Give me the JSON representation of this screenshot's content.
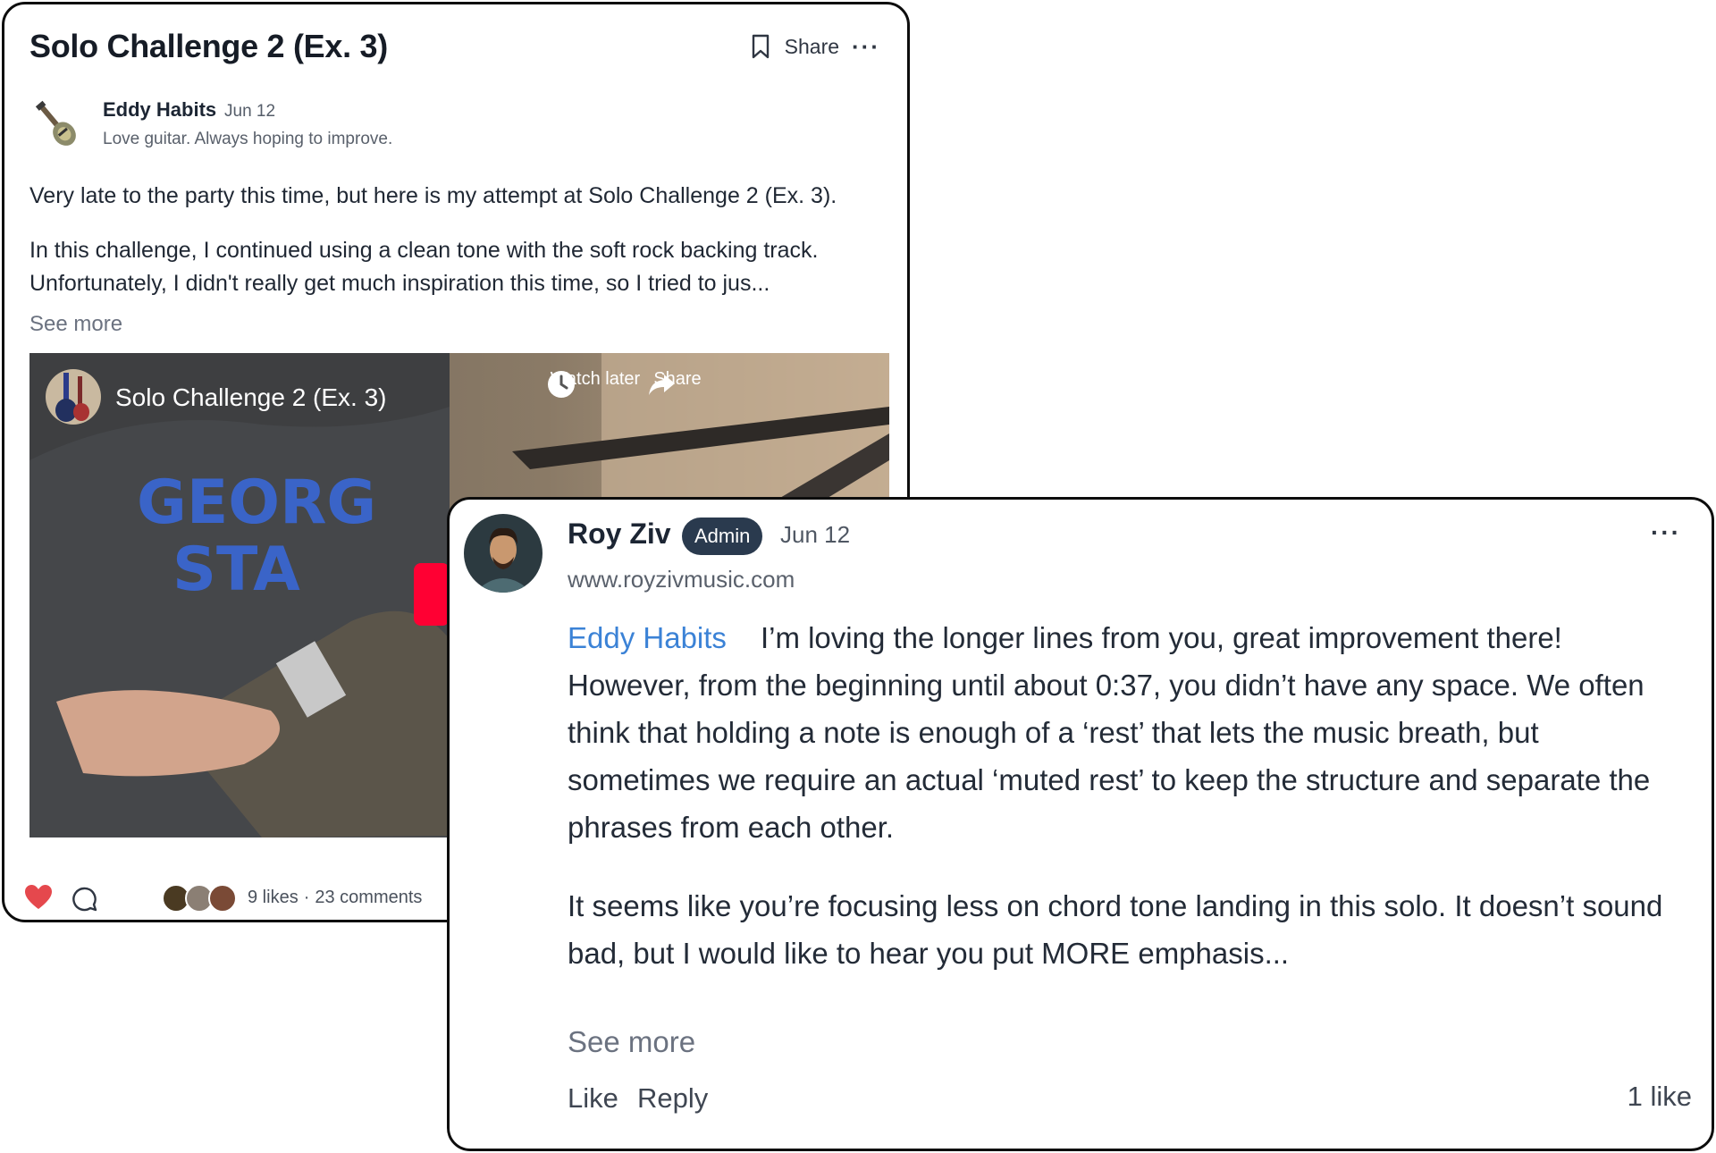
{
  "post": {
    "title": "Solo Challenge 2 (Ex. 3)",
    "share_label": "Share",
    "more_label": "···",
    "author": {
      "name": "Eddy Habits",
      "date": "Jun 12",
      "bio": "Love guitar. Always hoping to improve."
    },
    "body": [
      "Very late to the party this time, but here is my attempt at Solo Challenge 2 (Ex. 3).",
      "In this challenge, I continued using a clean tone with the soft rock backing track. Unfortunately, I didn't really get much inspiration this time, so I tried to jus..."
    ],
    "see_more": "See more",
    "video": {
      "title": "Solo Challenge 2 (Ex. 3)",
      "watch_later_label": "Watch later",
      "share_label": "Share"
    },
    "footer": {
      "likes": "9 likes",
      "separator": "·",
      "comments": "23 comments"
    }
  },
  "comment": {
    "author": "Roy Ziv",
    "badge": "Admin",
    "date": "Jun 12",
    "website": "www.royzivmusic.com",
    "more_label": "···",
    "mention": "Eddy Habits",
    "paragraph1": "I’m loving the longer lines from you, great improvement there! However, from the beginning until about 0:37, you didn’t have any space. We often think that holding a note is enough of a ‘rest’ that lets the music breath, but sometimes we require an actual ‘muted rest’ to keep the structure and separate the phrases from each other.",
    "paragraph2": "It seems like you’re focusing less on chord tone landing in this solo. It doesn’t sound bad, but I would like to hear you put MORE emphasis...",
    "see_more": "See more",
    "like_label": "Like",
    "reply_label": "Reply",
    "likes_count": "1 like"
  },
  "colors": {
    "heart": "#e5484d",
    "mention": "#3b82d6",
    "badge_bg": "#2a3a4e",
    "video_red": "#ff0033"
  },
  "icons": [
    "bookmark-icon",
    "more-icon",
    "watch-later-icon",
    "share-arrow-icon",
    "heart-icon",
    "comment-icon"
  ]
}
